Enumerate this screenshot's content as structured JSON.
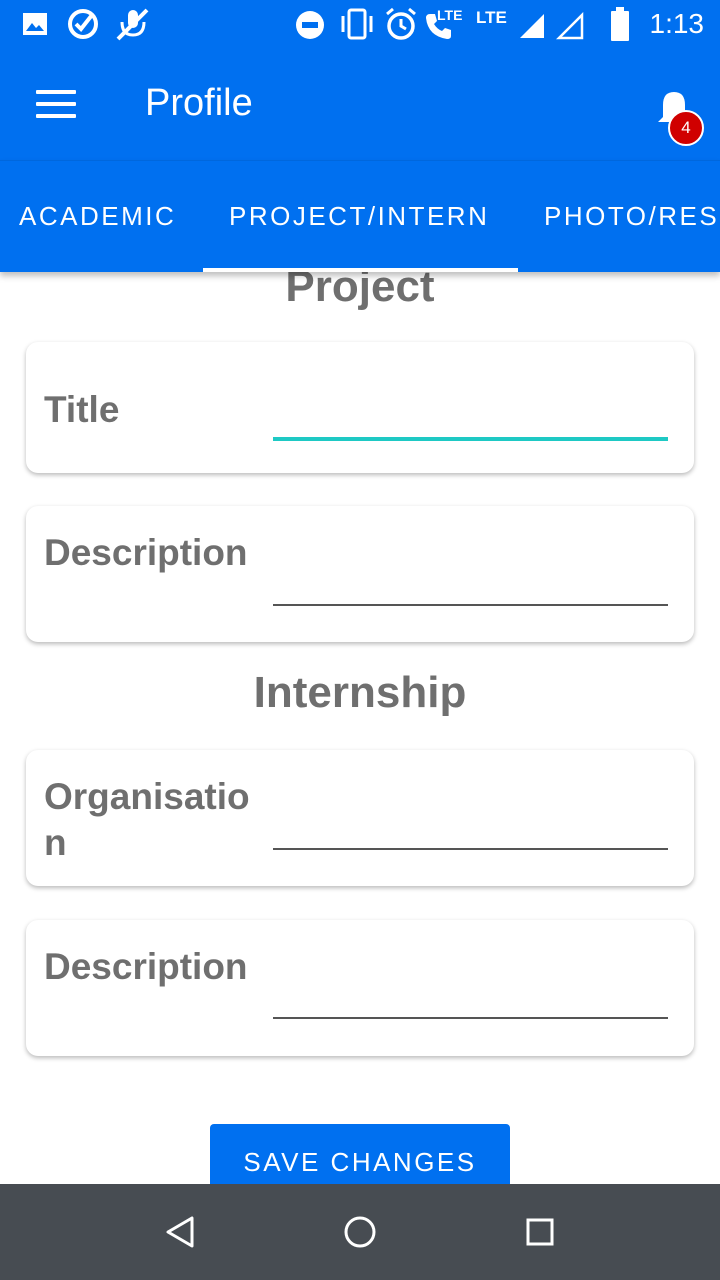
{
  "status_bar": {
    "time": "1:13",
    "lte1": "LTE",
    "lte2": "LTE",
    "icons": [
      "image-icon",
      "check-circle-icon",
      "mic-off-icon",
      "do-not-disturb-icon",
      "vibrate-icon",
      "alarm-icon",
      "wifi-call-icon",
      "signal-icon",
      "signal-outline-icon",
      "battery-icon"
    ]
  },
  "app_bar": {
    "title": "Profile",
    "notification_count": "4",
    "colors": {
      "primary": "#0070f0",
      "badge": "#d00000"
    }
  },
  "tabs": [
    {
      "label": "ACADEMIC",
      "selected": false
    },
    {
      "label": "PROJECT/INTERN",
      "selected": true
    },
    {
      "label": "PHOTO/RES",
      "selected": false
    }
  ],
  "project": {
    "heading": "Project",
    "fields": [
      {
        "label": "Title",
        "value": "",
        "focused": true
      },
      {
        "label": "Description",
        "value": "",
        "focused": false
      }
    ]
  },
  "internship": {
    "heading": "Internship",
    "fields": [
      {
        "label": "Organisation",
        "value": "",
        "focused": false
      },
      {
        "label": "Description",
        "value": "",
        "focused": false
      }
    ]
  },
  "save_label": "SAVE CHANGES",
  "nav": [
    "back-icon",
    "home-icon",
    "recents-icon"
  ]
}
